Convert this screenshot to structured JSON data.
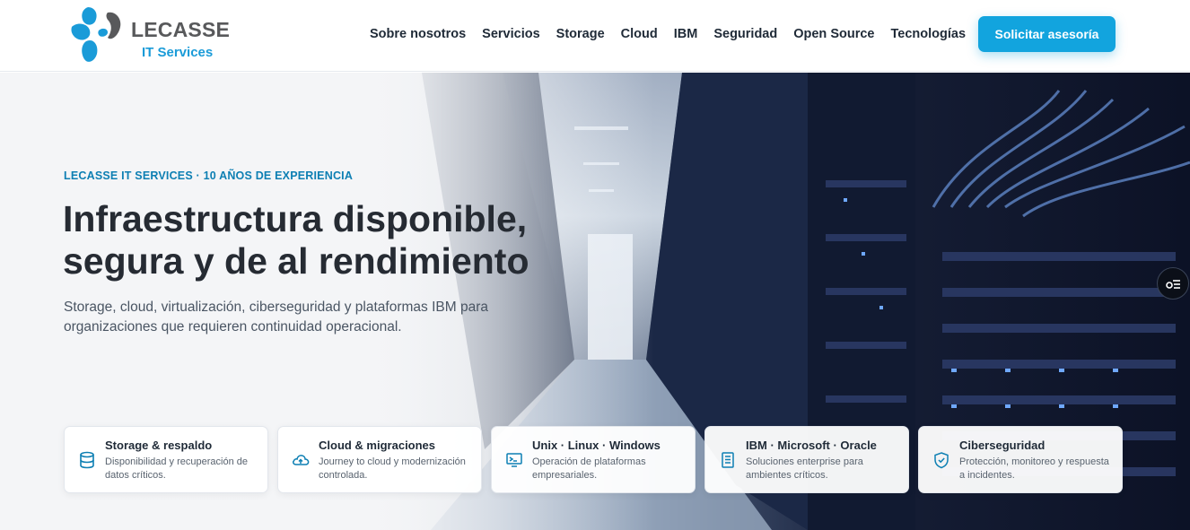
{
  "brand": {
    "name": "LECASSE",
    "subtitle": "IT Services",
    "colors": {
      "accent": "#12a4de",
      "accent_dark": "#0d7fb3",
      "logo_grey": "#58595b"
    }
  },
  "nav": {
    "items": [
      "Sobre nosotros",
      "Servicios",
      "Storage",
      "Cloud",
      "IBM",
      "Seguridad",
      "Open Source",
      "Tecnologías"
    ],
    "cta": "Solicitar asesoría"
  },
  "hero": {
    "eyebrow": "LECASSE IT SERVICES · 10 AÑOS DE EXPERIENCIA",
    "title_line1": "Infraestructura disponible,",
    "title_line2": "segura y de al rendimiento",
    "lead": "Storage, cloud, virtualización, ciberseguridad y plataformas IBM para organizaciones que requieren continuidad operacional."
  },
  "side_button": {
    "icon": "accessibility-menu-icon"
  },
  "cards": [
    {
      "icon": "database-icon",
      "title": "Storage & respaldo",
      "desc": "Disponibilidad y recuperación de datos críticos."
    },
    {
      "icon": "cloud-upload-icon",
      "title": "Cloud & migraciones",
      "desc": "Journey to cloud y modernización controlada."
    },
    {
      "icon": "monitor-terminal-icon",
      "title": "Unix · Linux · Windows",
      "desc": "Operación de plataformas empresariales."
    },
    {
      "icon": "document-icon",
      "title": "IBM · Microsoft · Oracle",
      "desc": "Soluciones enterprise para ambientes críticos."
    },
    {
      "icon": "shield-check-icon",
      "title": "Ciberseguridad",
      "desc": "Protección, monitoreo y respuesta a incidentes."
    }
  ]
}
